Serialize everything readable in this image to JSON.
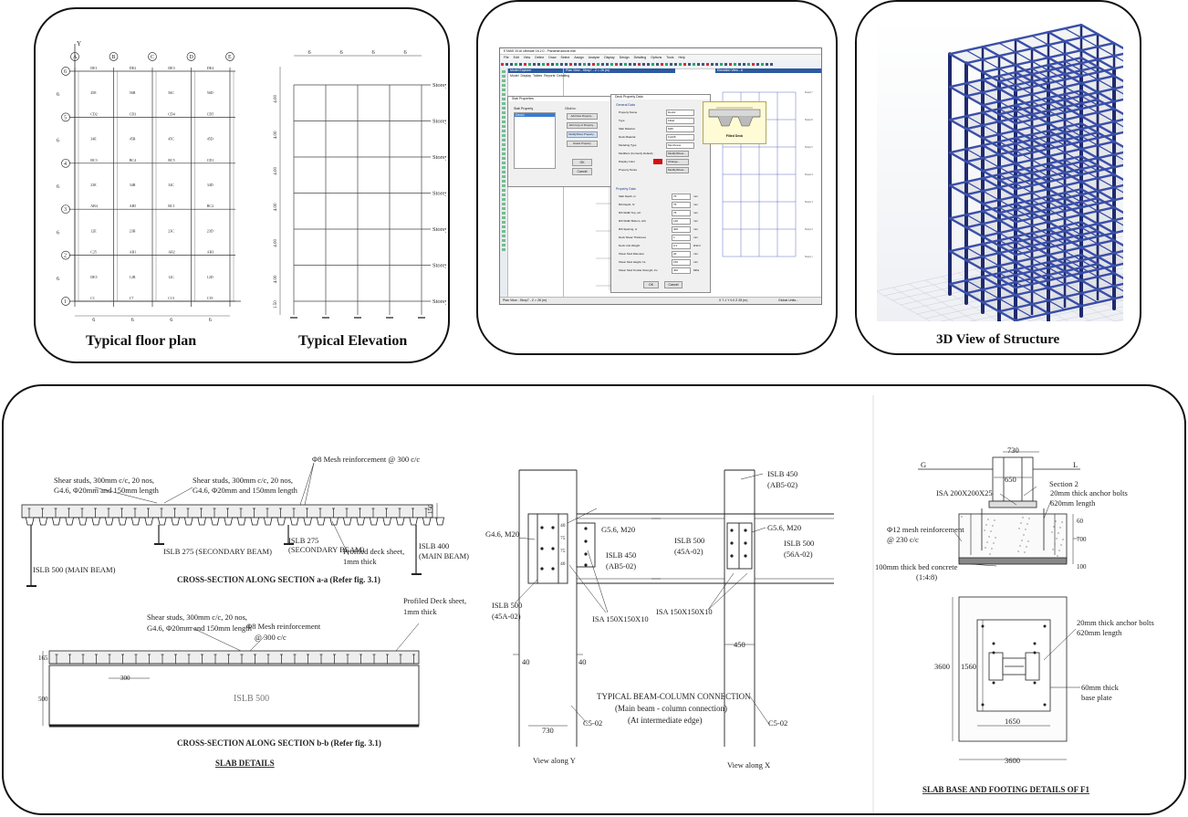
{
  "panel_plan": {
    "caption_plan": "Typical floor plan",
    "caption_elevation": "Typical Elevation",
    "grid_columns": [
      "A",
      "B",
      "C",
      "D",
      "E"
    ],
    "grid_rows": [
      "1",
      "2",
      "3",
      "4",
      "5",
      "6"
    ],
    "bay_dims": [
      "6",
      "6",
      "6",
      "6"
    ],
    "axis_x": "X",
    "axis_y": "Y",
    "storeys": [
      "Storey 7",
      "Storey 6",
      "Storey 5",
      "Storey 4",
      "Storey 3",
      "Storey 2",
      "Storey 1"
    ],
    "elev_dims": [
      "6",
      "6",
      "6",
      "6"
    ],
    "story_heights": [
      "4.00",
      "4.00",
      "4.00",
      "4.00",
      "4.00",
      "4.00",
      "1.50"
    ],
    "plan_labels": [
      "C1",
      "C7",
      "C13",
      "C19",
      "C25",
      "AB1",
      "AB2",
      "AB3",
      "AB4",
      "AB5",
      "BC1",
      "BC2",
      "BC3",
      "BC4",
      "BC5",
      "CD1",
      "CD2",
      "CD3",
      "CD4",
      "CD5",
      "DE1",
      "DE2",
      "DE3",
      "DE4",
      "DE5",
      "12B",
      "12C",
      "12D",
      "12E",
      "23B",
      "23C",
      "23D",
      "23E",
      "34B",
      "34C",
      "34D",
      "34E",
      "45B",
      "45C",
      "45D",
      "45E",
      "56B",
      "56C",
      "56D",
      "56E",
      "12A",
      "23A",
      "34A",
      "45A",
      "56A"
    ]
  },
  "panel_software": {
    "title": "ETABS 2016 Ultimate 16.2.0 - Planarstructural.edb",
    "menu": [
      "File",
      "Edit",
      "View",
      "Define",
      "Draw",
      "Select",
      "Assign",
      "Analyze",
      "Display",
      "Design",
      "Detailing",
      "Options",
      "Tools",
      "Help"
    ],
    "tabs": [
      "Model Explorer",
      "Plan View - Story7 - Z = 28 (m)",
      "Elevation View - A"
    ],
    "explorer_tabs": [
      "Model",
      "Display",
      "Tables",
      "Reports",
      "Detailing"
    ],
    "slab_dialog_title": "Slab Properties",
    "slab_list_header": "Slab Property",
    "slab_list_item": "Deck1",
    "click_to": "Click to:",
    "buttons": [
      "Add New Property...",
      "Add Copy of Property...",
      "Modify/Show Property...",
      "Delete Property"
    ],
    "ok": "OK",
    "cancel": "Cancel",
    "deck_dialog_title": "Deck Property Data",
    "general_data": "General Data",
    "general_fields": [
      "Property Name",
      "Type",
      "Slab Material",
      "Deck Material",
      "Modeling Type",
      "Modifiers (Currently Default)",
      "Display Color",
      "Property Notes"
    ],
    "general_values": [
      "Deck1",
      "Filled",
      "M25",
      "Fe345",
      "Membrane",
      "Modify/Show...",
      "Change...",
      "Modify/Show..."
    ],
    "property_data": "Property Data",
    "property_fields": [
      "Slab Depth, tc",
      "Rib Depth, hr",
      "Rib Width Top, wrt",
      "Rib Width Bottom, wrb",
      "Rib Spacing, sr",
      "Deck Shear Thickness",
      "Deck Unit Weight",
      "Shear Stud Diameter",
      "Shear Stud Height, hs",
      "Shear Stud Tensile Strength, Fu"
    ],
    "property_values": [
      "75",
      "75",
      "75",
      "120",
      "300",
      "1",
      "0.1",
      "20",
      "150",
      "400"
    ],
    "property_units": [
      "mm",
      "mm",
      "mm",
      "mm",
      "mm",
      "mm",
      "kN/m²",
      "mm",
      "mm",
      "MPa"
    ],
    "filled_deck": "Filled Deck",
    "status_left": "Plan View - Story7 - Z = 28 (m)",
    "status_right": "X 7.1  Y 0.0  Z 28 (m)",
    "units": "Global   Units..."
  },
  "panel_3d": {
    "caption": "3D View of Structure"
  },
  "panel_details": {
    "slab": {
      "studs_a1": "Shear studs, 300mm c/c, 20 nos,",
      "studs_a2": "G4.6, Φ20mm and 150mm length",
      "studs_b1": "Shear studs, 300mm c/c, 20 nos,",
      "studs_b2": "G4.6, Φ20mm and 150mm length",
      "mesh_a": "Φ8 Mesh reinforcement @ 300 c/c",
      "dim_a": "150",
      "main_beam_l": "ISLB 500 (MAIN BEAM)",
      "secondary_1": "ISLB 275 (SECONDARY BEAM)",
      "secondary_2a": "ISLB 275",
      "secondary_2b": "(SECONDARY BEAM)",
      "deck_a1": "Profiled deck sheet,",
      "deck_a2": "1mm thick",
      "main_beam_r1": "ISLB 400",
      "main_beam_r2": "(MAIN BEAM)",
      "section_a": "CROSS-SECTION ALONG SECTION a-a (Refer fig. 3.1)",
      "studs_c1": "Shear studs, 300mm c/c, 20 nos,",
      "studs_c2": "G4.6, Φ20mm and 150mm length",
      "mesh_b1": "Φ8 Mesh reinforcement",
      "mesh_b2": "@ 300 c/c",
      "deck_b1": "Profiled Deck sheet,",
      "deck_b2": "1mm thick",
      "dim_165": "165",
      "dim_300": "300",
      "dim_500": "500",
      "islb500": "ISLB 500",
      "section_b": "CROSS-SECTION ALONG SECTION b-b (Refer fig. 3.1)",
      "title": "SLAB DETAILS"
    },
    "connection": {
      "g46": "G4.6, M20",
      "g56a": "G5.6, M20",
      "islb450a": "ISLB 450",
      "ab502a": "(AB5-02)",
      "islb500a": "ISLB 500",
      "a45_02a": "(45A-02)",
      "isa1": "ISA 150X150X10",
      "d40a": "40",
      "d40b": "40",
      "d730": "730",
      "c502a": "C5-02",
      "view_y": "View along Y",
      "islb450b": "ISLB 450",
      "ab502b": "(AB5-02)",
      "islb500b": "ISLB 500",
      "a45_02b": "(45A-02)",
      "g56b": "G5.6, M20",
      "islb500c": "ISLB 500",
      "a56_02": "(56A-02)",
      "isa2": "ISA 150X150X10",
      "d450": "450",
      "c502b": "C5-02",
      "view_x": "View along X",
      "title1": "TYPICAL BEAM-COLUMN CONNECTION",
      "title2": "(Main beam - column connection)",
      "title3": "(At intermediate edge)",
      "bolt_dims": [
        "40",
        "75",
        "75",
        "40"
      ]
    },
    "footing": {
      "d730": "730",
      "g": "G",
      "l": "L",
      "d650": "650",
      "section2": "Section 2",
      "isa200": "ISA 200X200X25",
      "anchor1": "20mm thick anchor bolts",
      "anchor1b": "620mm length",
      "mesh1": "Φ12 mesh reinforcement",
      "mesh2": "@ 230 c/c",
      "d60": "60",
      "d700": "700",
      "bed1": "100mm thick bed concrete",
      "bed2": "(1:4:8)",
      "d100": "100",
      "anchor2": "20mm thick anchor bolts",
      "anchor2b": "620mm length",
      "d3600v": "3600",
      "d1560": "1560",
      "plate1": "60mm thick",
      "plate2": "base plate",
      "d1650": "1650",
      "d3600h": "3600",
      "title": "SLAB BASE AND FOOTING DETAILS OF F1"
    }
  },
  "colors": {
    "frame_blue": "#3a4fa8",
    "frame_dark": "#1f2a6e",
    "deck_red": "#d31010"
  }
}
